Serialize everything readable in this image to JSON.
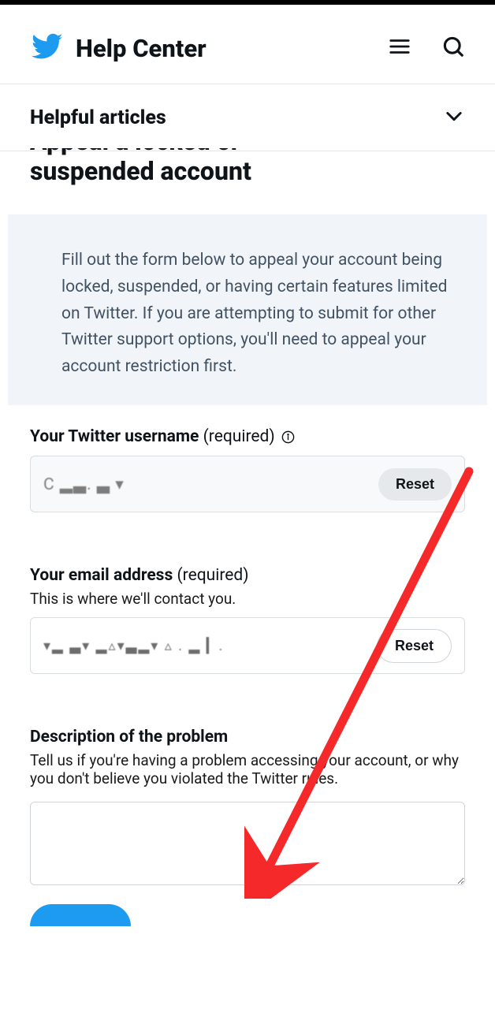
{
  "header": {
    "title": "Help Center"
  },
  "articles_bar": {
    "title": "Helpful articles"
  },
  "page_title": {
    "line1_cut": "Appeal a locked or",
    "line2": "suspended account"
  },
  "info_box": {
    "text": "Fill out the form below to appeal your account being locked, suspended, or having certain features limited on Twitter. If you are attempting to submit for other Twitter support options, you'll need to appeal your account restriction first."
  },
  "form": {
    "username": {
      "label_bold": "Your Twitter username",
      "label_required": "(required)",
      "value_redacted": "C ▂▃.  ▃  ▾",
      "reset": "Reset"
    },
    "email": {
      "label_bold": "Your email address",
      "label_required": "(required)",
      "helper": "This is where we'll contact you.",
      "value_redacted": "▾▂  ▃▾  ▂▵▾▃▂▾  ▵ . ▂  ▎.",
      "reset": "Reset"
    },
    "description": {
      "label_bold": "Description of the problem",
      "helper": "Tell us if you're having a problem accessing your account, or why you don't believe you violated the Twitter rules.",
      "value": ""
    }
  },
  "colors": {
    "twitter_blue": "#1d9bf0",
    "red_arrow": "#f52929",
    "info_bg": "#f1f5f9"
  }
}
